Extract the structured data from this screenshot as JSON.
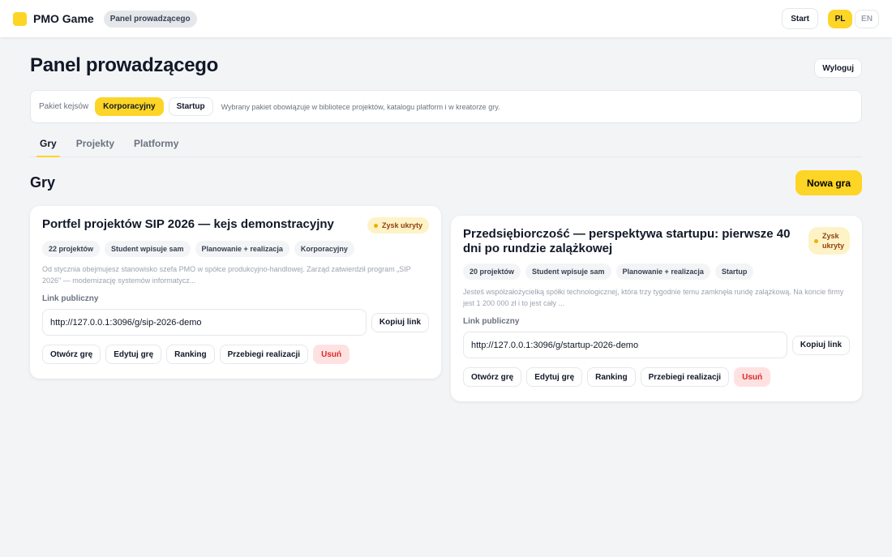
{
  "header": {
    "brand": "PMO Game",
    "crumb": "Panel prowadzącego",
    "start": "Start",
    "langs": [
      "PL",
      "EN"
    ]
  },
  "page": {
    "title": "Panel prowadzącego",
    "logout": "Wyloguj"
  },
  "pack": {
    "label": "Pakiet kejsów",
    "options": [
      "Korporacyjny",
      "Startup"
    ],
    "selected": "Korporacyjny",
    "note": "Wybrany pakiet obowiązuje w bibliotece projektów, katalogu platform i w kreatorze gry."
  },
  "tabs": [
    "Gry",
    "Projekty",
    "Platformy"
  ],
  "section": {
    "title": "Gry",
    "new_game": "Nowa gra"
  },
  "games": [
    {
      "title": "Portfel projektów SIP 2026 — kejs demonstracyjny",
      "badge": "Zysk ukryty",
      "tags": [
        "22 projektów",
        "Student wpisuje sam",
        "Planowanie + realizacja",
        "Korporacyjny"
      ],
      "desc": "Od stycznia obejmujesz stanowisko szefa PMO w spółce produkcyjno-handlowej. Zarząd zatwierdził program „SIP 2026\" — modernizację systemów informatycz...",
      "link_label": "Link publiczny",
      "link": "http://127.0.0.1:3096/g/sip-2026-demo",
      "copy": "Kopiuj link",
      "actions": [
        "Otwórz grę",
        "Edytuj grę",
        "Ranking",
        "Przebiegi realizacji",
        "Usuń"
      ]
    },
    {
      "title": "Przedsiębiorczość — perspektywa startupu: pierwsze 40 dni po rundzie zalążkowej",
      "badge": "Zysk ukryty",
      "tags": [
        "20 projektów",
        "Student wpisuje sam",
        "Planowanie + realizacja",
        "Startup"
      ],
      "desc": "Jesteś współzałożycielką spółki technologicznej, która trzy tygodnie temu zamknęła rundę zalążkową. Na koncie firmy jest 1 200 000 zł i to jest cały ...",
      "link_label": "Link publiczny",
      "link": "http://127.0.0.1:3096/g/startup-2026-demo",
      "copy": "Kopiuj link",
      "actions": [
        "Otwórz grę",
        "Edytuj grę",
        "Ranking",
        "Przebiegi realizacji",
        "Usuń"
      ]
    }
  ],
  "colors": {
    "accent": "#fcd526",
    "danger": "#dc2626"
  }
}
